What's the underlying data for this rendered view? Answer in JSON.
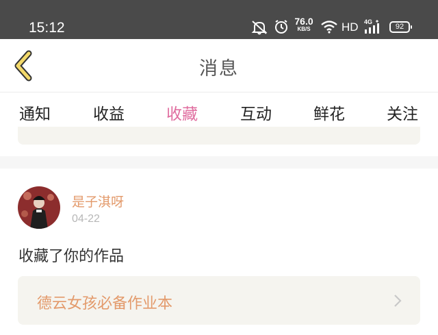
{
  "status_bar": {
    "time": "15:12",
    "speed_value": "76.0",
    "speed_unit": "KB/S",
    "hd": "HD",
    "network": "4G",
    "battery": "92"
  },
  "nav": {
    "title": "消息"
  },
  "tabs": [
    {
      "label": "通知"
    },
    {
      "label": "收益"
    },
    {
      "label": "收藏",
      "active": true
    },
    {
      "label": "互动"
    },
    {
      "label": "鲜花"
    },
    {
      "label": "关注"
    }
  ],
  "notification": {
    "username": "是子淇呀",
    "date": "04-22",
    "message": "收藏了你的作品",
    "work_title": "德云女孩必备作业本"
  },
  "colors": {
    "accent": "#e06d9f",
    "username": "#e39a6b",
    "status_bar_bg": "#4a4a4a",
    "back_icon": "#f3d96a"
  }
}
